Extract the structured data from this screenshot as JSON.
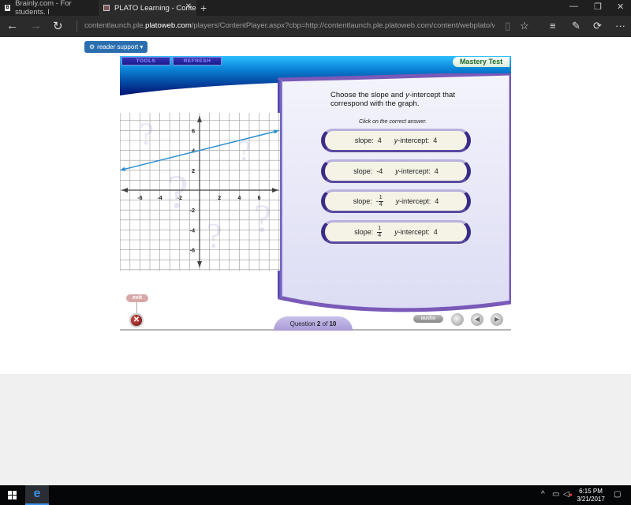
{
  "browser": {
    "tabs": [
      {
        "title": "Brainly.com - For students. I",
        "favicon": "brainly-favicon"
      },
      {
        "title": "PLATO Learning - Conte",
        "favicon": "plato-favicon",
        "active": true
      }
    ],
    "new_tab_label": "+",
    "window_controls": {
      "minimize": "—",
      "maximize": "❐",
      "close": "✕"
    },
    "nav": {
      "back": "←",
      "forward": "→",
      "refresh": "↻"
    },
    "url_prefix": "contentlaunch.ple.",
    "url_domain": "platoweb.com",
    "url_suffix": "/players/ContentPlayer.aspx?cbp=http://contentlaunch.ple.platoweb.com/content/webplato/wpmx_cmma/&cwlty",
    "toolbar_icons": {
      "reading_view": "📖",
      "favorite": "☆",
      "hub": "≡",
      "web_note": "✎",
      "share": "⟳",
      "more": "···"
    }
  },
  "page": {
    "reader_support_label": "reader support ▾",
    "reader_support_icon": "⚙"
  },
  "player": {
    "tools_label": "TOOLS",
    "refresh_label": "REFRESH",
    "mode_label": "Mastery Test",
    "question_text_pre": "Choose the slope and ",
    "question_text_italic": "y",
    "question_text_post": "-intercept that correspond with the graph.",
    "instruction": "Click on the correct answer.",
    "answers": [
      {
        "slope_label": "slope:",
        "slope_sign": "",
        "slope_whole": "4",
        "slope_num": "",
        "slope_den": "",
        "yint_label_italic": "y",
        "yint_label_rest": "-intercept:",
        "yint_value": "4"
      },
      {
        "slope_label": "slope:",
        "slope_sign": "",
        "slope_whole": "-4",
        "slope_num": "",
        "slope_den": "",
        "yint_label_italic": "y",
        "yint_label_rest": "-intercept:",
        "yint_value": "4"
      },
      {
        "slope_label": "slope:",
        "slope_sign": "-",
        "slope_whole": "",
        "slope_num": "1",
        "slope_den": "4",
        "yint_label_italic": "y",
        "yint_label_rest": "-intercept:",
        "yint_value": "4"
      },
      {
        "slope_label": "slope:",
        "slope_sign": "",
        "slope_whole": "",
        "slope_num": "1",
        "slope_den": "4",
        "yint_label_italic": "y",
        "yint_label_rest": "-intercept:",
        "yint_value": "4"
      }
    ],
    "exit_label": "exit",
    "exit_icon": "✕",
    "question_counter": {
      "prefix": "Question",
      "current": "2",
      "of": "of",
      "total": "10"
    },
    "audio_label": "audio",
    "prev_icon": "◀",
    "next_icon": "▶"
  },
  "graph": {
    "x_ticks": [
      "-6",
      "-4",
      "-2",
      "2",
      "4",
      "6"
    ],
    "y_ticks": [
      "6",
      "4",
      "2",
      "-2",
      "-4",
      "-6"
    ],
    "x_range": [
      -8,
      8
    ],
    "y_range": [
      -8,
      8
    ],
    "line": {
      "slope": 0.25,
      "intercept": 4,
      "x_from": -8,
      "x_to": 8
    },
    "line_color": "#2a8fd0"
  },
  "taskbar": {
    "start_icon": "windows-logo",
    "edge_icon": "e",
    "tray_chevron": "^",
    "tray_network": "🖧",
    "tray_volume": "🔈",
    "time": "6:15 PM",
    "date": "3/21/2017",
    "notifications_icon": "🗨"
  }
}
